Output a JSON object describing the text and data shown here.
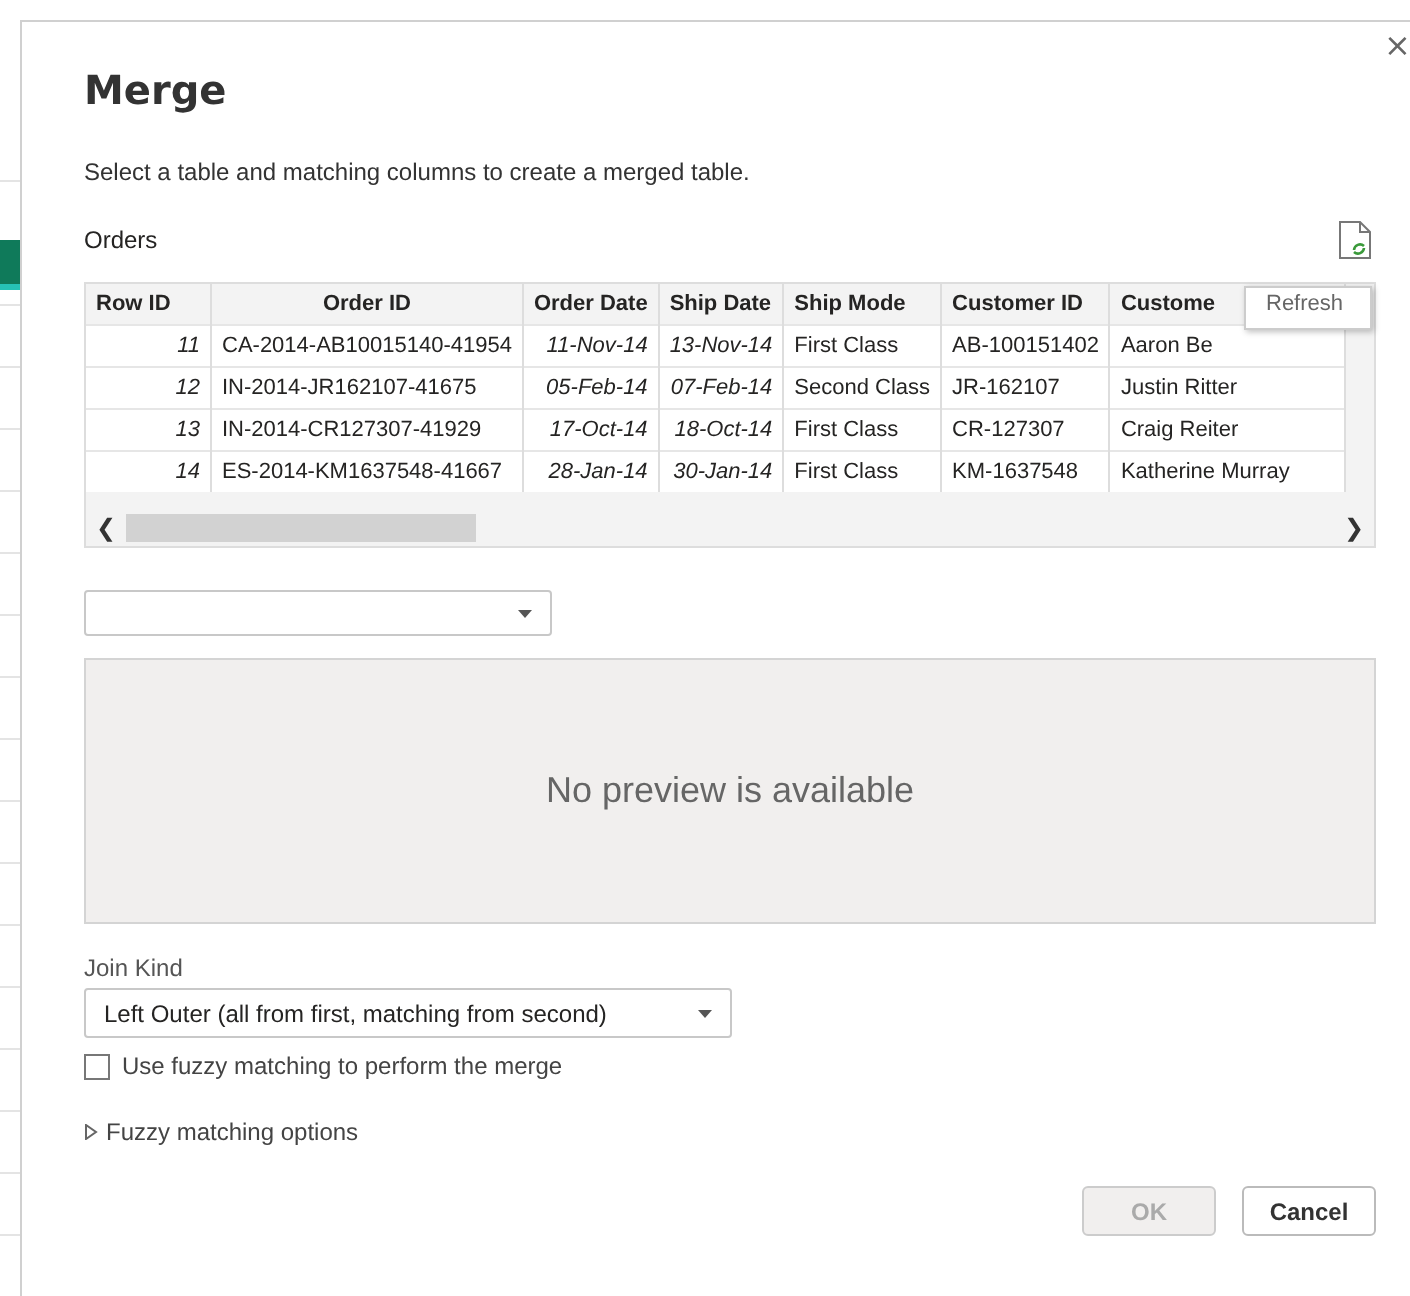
{
  "dialog": {
    "title": "Merge",
    "close": "×",
    "instruction": "Select a table and matching columns to create a merged table.",
    "table_label": "Orders",
    "table": {
      "columns": [
        "Row ID",
        "Order ID",
        "Order Date",
        "Ship Date",
        "Ship Mode",
        "Customer ID",
        "Custome"
      ],
      "rows": [
        [
          "11",
          "CA-2014-AB10015140-41954",
          "11-Nov-14",
          "13-Nov-14",
          "First Class",
          "AB-100151402",
          "Aaron Be"
        ],
        [
          "12",
          "IN-2014-JR162107-41675",
          "05-Feb-14",
          "07-Feb-14",
          "Second Class",
          "JR-162107",
          "Justin Ritter"
        ],
        [
          "13",
          "IN-2014-CR127307-41929",
          "17-Oct-14",
          "18-Oct-14",
          "First Class",
          "CR-127307",
          "Craig Reiter"
        ],
        [
          "14",
          "ES-2014-KM1637548-41667",
          "28-Jan-14",
          "30-Jan-14",
          "First Class",
          "KM-1637548",
          "Katherine Murray"
        ]
      ],
      "scroll_left": "❮",
      "scroll_right": "❯"
    },
    "tooltip": "Refresh",
    "preview_message": "No preview is available",
    "join_kind": {
      "label": "Join Kind",
      "value": "Left Outer (all from first, matching from second)"
    },
    "fuzzy_checkbox": {
      "label": "Use fuzzy matching to perform the merge",
      "checked": false
    },
    "fuzzy_options": {
      "label": "Fuzzy matching options",
      "expanded": false
    },
    "buttons": [
      {
        "label": "OK",
        "disabled": true
      },
      {
        "label": "Cancel",
        "disabled": false
      }
    ]
  }
}
